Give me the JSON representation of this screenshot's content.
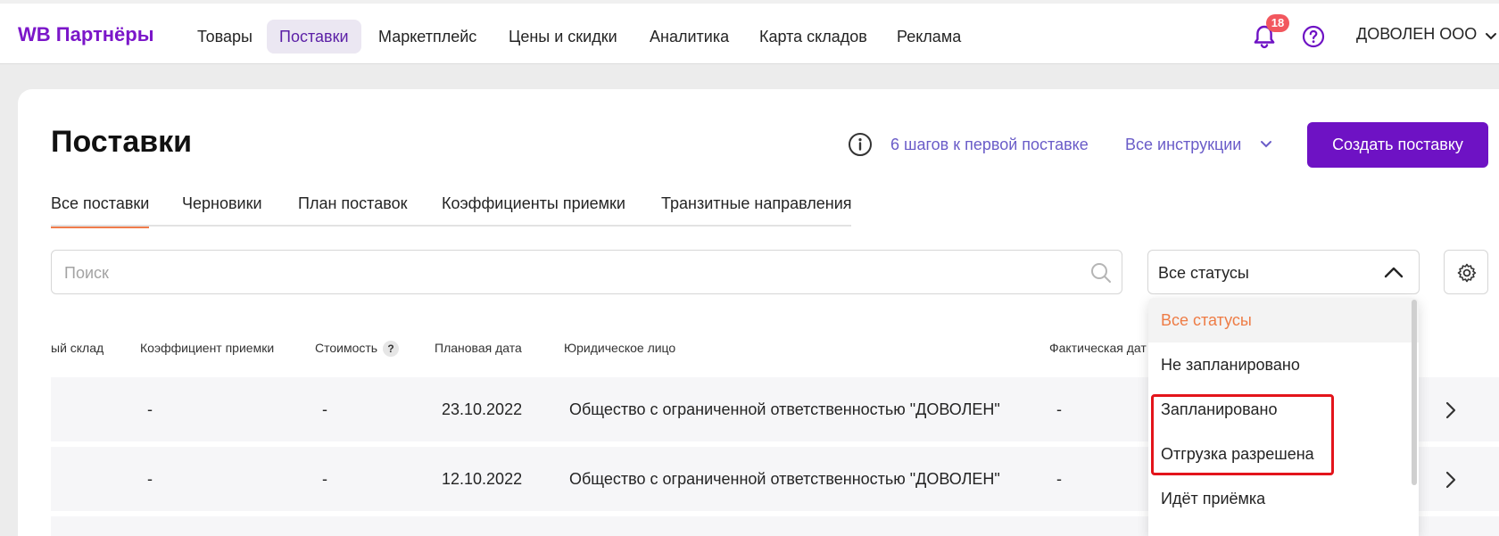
{
  "header": {
    "logo": "WB Партнёры",
    "nav": [
      "Товары",
      "Поставки",
      "Маркетплейс",
      "Цены и скидки",
      "Аналитика",
      "Карта складов",
      "Реклама"
    ],
    "active_nav_index": 1,
    "notification_count": "18",
    "account_name": "ДОВОЛЕН ООО"
  },
  "page": {
    "title": "Поставки",
    "steps_link": "6 шагов к первой поставке",
    "instructions_link": "Все инструкции",
    "create_button": "Создать поставку"
  },
  "tabs": [
    "Все поставки",
    "Черновики",
    "План поставок",
    "Коэффициенты приемки",
    "Транзитные направления"
  ],
  "active_tab_index": 0,
  "search": {
    "placeholder": "Поиск",
    "value": ""
  },
  "status_filter": {
    "value": "Все статусы",
    "options": [
      "Все статусы",
      "Не запланировано",
      "Запланировано",
      "Отгрузка разрешена",
      "Идёт приёмка"
    ],
    "selected_index": 0
  },
  "table": {
    "columns": [
      "ый склад",
      "Коэффициент приемки",
      "Стоимость",
      "Плановая дата",
      "Юридическое лицо",
      "Фактическая дат"
    ],
    "cost_help": "?",
    "rows": [
      [
        "-",
        "-",
        "23.10.2022",
        "Общество с ограниченной ответственностью \"ДОВОЛЕН\"",
        "-"
      ],
      [
        "-",
        "-",
        "12.10.2022",
        "Общество с ограниченной ответственностью \"ДОВОЛЕН\"",
        "-"
      ]
    ]
  },
  "colors": {
    "brand": "#7b16c9",
    "primary_button": "#6e12c4",
    "link": "#6a5cc8",
    "active_tab_underline": "#f07c4b",
    "selected_option": "#ee7c45",
    "badge": "#f2575e",
    "highlight": "#e3141b"
  },
  "icons": [
    "bell-icon",
    "help-icon",
    "chevron-down-icon",
    "info-icon",
    "search-icon",
    "chevron-up-icon",
    "gear-icon",
    "chevron-right-icon"
  ]
}
